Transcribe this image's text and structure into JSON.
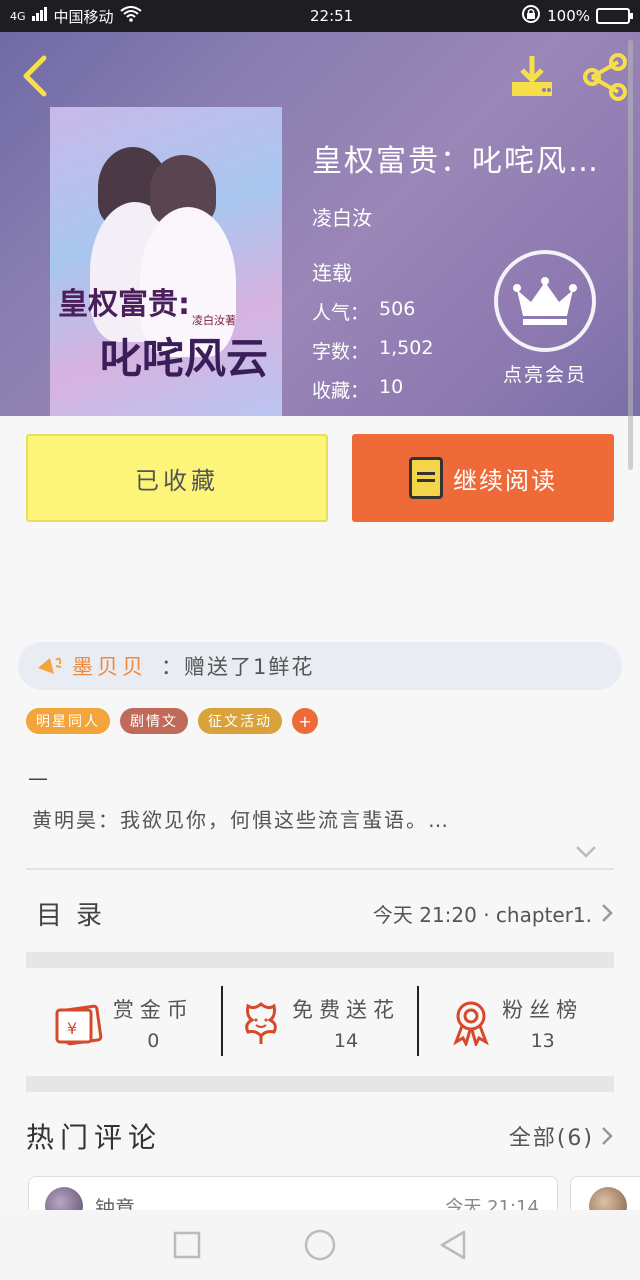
{
  "status_bar": {
    "signal": "4G",
    "carrier": "中国移动",
    "time": "22:51",
    "battery": "100%"
  },
  "book": {
    "title": "皇权富贵：叱咤风…",
    "author": "凌白汝",
    "status": "连载",
    "stats": [
      {
        "label": "人气：",
        "value": "506"
      },
      {
        "label": "字数：",
        "value": "1,502"
      },
      {
        "label": "收藏：",
        "value": "10"
      }
    ],
    "vip_label": "点亮会员",
    "cover": {
      "title_line1": "皇权富贵:",
      "title_line2": "叱咤风云",
      "author_small": "凌白汝著"
    }
  },
  "actions": {
    "favorite_label": "已收藏",
    "read_label": "继续阅读"
  },
  "flower_notice": {
    "name": "墨贝贝",
    "text": "：赠送了1鲜花"
  },
  "tags": [
    {
      "label": "明星同人",
      "color": "#f3a43a"
    },
    {
      "label": "剧情文",
      "color": "#c06a5a"
    },
    {
      "label": "征文活动",
      "color": "#d9a23a"
    }
  ],
  "tag_add": "+",
  "intro": {
    "dash": "—",
    "text": "黄明昊：我欲见你，何惧这些流言蜚语。…"
  },
  "catalog": {
    "label": "目录",
    "update": "今天 21:20 · chapter1."
  },
  "rewards": [
    {
      "label": "赏金币",
      "count": "0",
      "icon": "red-envelope-icon"
    },
    {
      "label": "免费送花",
      "count": "14",
      "icon": "flower-icon"
    },
    {
      "label": "粉丝榜",
      "count": "13",
      "icon": "medal-icon"
    }
  ],
  "comments": {
    "title": "热门评论",
    "all_label": "全部(6)",
    "first": {
      "user": "钟意",
      "time": "今天 21:14"
    }
  },
  "colors": {
    "accent_orange": "#ee6a38",
    "favorite_yellow": "#fdf57a"
  }
}
